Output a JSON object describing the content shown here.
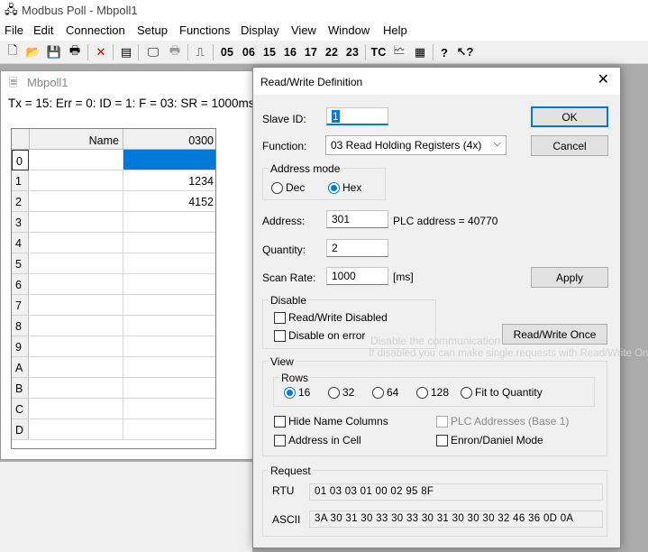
{
  "app": {
    "title": "Modbus Poll - Mbpoll1",
    "menu": [
      "File",
      "Edit",
      "Connection",
      "Setup",
      "Functions",
      "Display",
      "View",
      "Window",
      "Help"
    ],
    "toolbar_text_buttons": [
      "05",
      "06",
      "15",
      "16",
      "17",
      "22",
      "23",
      "TC"
    ]
  },
  "child_window": {
    "title": "Mbpoll1",
    "status": "Tx = 15: Err = 0: ID = 1: F = 03: SR = 1000ms",
    "grid": {
      "headers": [
        "Name",
        "0300"
      ],
      "row_labels": [
        "0",
        "1",
        "2",
        "3",
        "4",
        "5",
        "6",
        "7",
        "8",
        "9",
        "A",
        "B",
        "C",
        "D"
      ],
      "values": [
        "",
        "1234",
        "4152",
        "",
        "",
        "",
        "",
        "",
        "",
        "",
        "",
        "",
        "",
        ""
      ]
    }
  },
  "dialog": {
    "title": "Read/Write Definition",
    "slave_id_label": "Slave ID:",
    "slave_id_value": "1",
    "ok_label": "OK",
    "cancel_label": "Cancel",
    "function_label": "Function:",
    "function_value": "03 Read Holding Registers (4x)",
    "address_mode": {
      "title": "Address mode",
      "options": [
        "Dec",
        "Hex"
      ],
      "selected": "Hex"
    },
    "address_label": "Address:",
    "address_value": "301",
    "plc_address_text": "PLC address = 40770",
    "quantity_label": "Quantity:",
    "quantity_value": "2",
    "scan_rate_label": "Scan Rate:",
    "scan_rate_value": "1000",
    "scan_rate_unit": "[ms]",
    "apply_label": "Apply",
    "disable": {
      "title": "Disable",
      "rw_disabled_label": "Read/Write Disabled",
      "disable_on_error_label": "Disable on error"
    },
    "rw_once_label": "Read/Write Once",
    "ghost_hint_1": "Disable the communication",
    "ghost_hint_2": "If disabled you can make single requests with Read/Write Once",
    "view": {
      "title": "View",
      "rows_title": "Rows",
      "row_options": [
        "16",
        "32",
        "64",
        "128",
        "Fit to Quantity"
      ],
      "rows_selected": "16",
      "hide_name_columns_label": "Hide Name Columns",
      "plc_addresses_label": "PLC Addresses (Base 1)",
      "address_in_cell_label": "Address in Cell",
      "enron_label": "Enron/Daniel Mode"
    },
    "request": {
      "title": "Request",
      "rtu_label": "RTU",
      "rtu_value": "01 03 03 01 00 02 95 8F",
      "ascii_label": "ASCII",
      "ascii_value": "3A 30 31 30 33 30 33 30 31 30 30 30 32 46 36 0D 0A"
    }
  }
}
